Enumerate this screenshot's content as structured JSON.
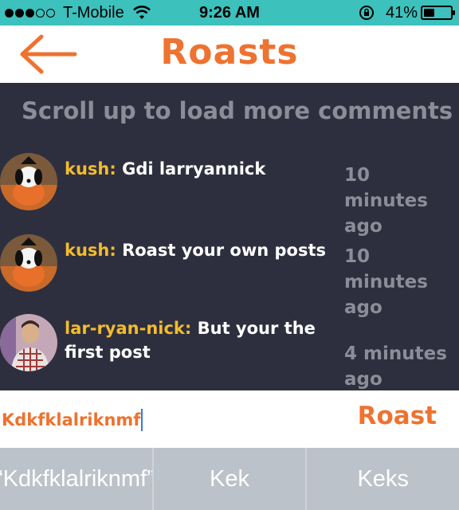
{
  "status_bar": {
    "carrier": "T-Mobile",
    "time": "9:26 AM",
    "battery": "41%",
    "battery_level": 0.41
  },
  "nav": {
    "title": "Roasts",
    "back_icon": "arrow-left-icon"
  },
  "comments": {
    "load_more": "Scroll up to load more comments",
    "items": [
      {
        "user": "kush:",
        "text": "Gdi larryannick",
        "time": "10 minutes ago",
        "avatar": "snoopy-avatar"
      },
      {
        "user": "kush:",
        "text": "Roast your own posts",
        "time": "10 minutes ago",
        "avatar": "snoopy-avatar"
      },
      {
        "user": "lar-ryan-nick:",
        "text": "But your the first post",
        "time": "4 minutes ago",
        "avatar": "person-avatar"
      }
    ]
  },
  "input": {
    "value": "Kdkfklalriknmf",
    "submit_label": "Roast"
  },
  "keyboard_suggestions": [
    "“Kdkfklalriknmf”",
    "Kek",
    "Keks"
  ],
  "colors": {
    "accent": "#ee7230",
    "status_bar": "#3cc1bd",
    "background": "#2e2f3e",
    "username": "#f3bc2d"
  }
}
